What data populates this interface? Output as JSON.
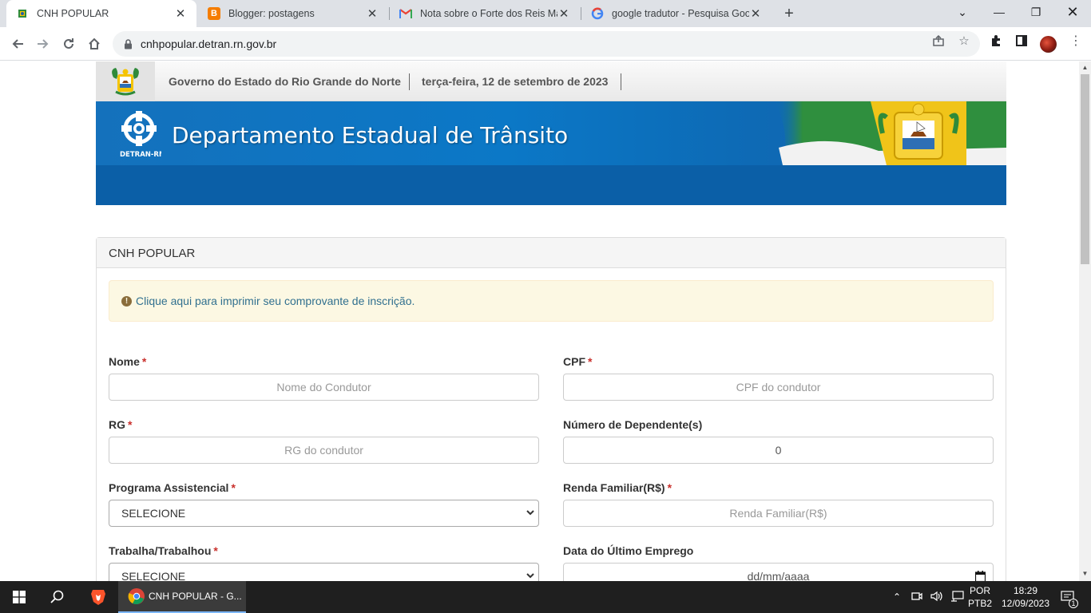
{
  "browser": {
    "tabs": [
      {
        "title": "CNH POPULAR",
        "active": true,
        "icon": "rn-crest-icon"
      },
      {
        "title": "Blogger: postagens",
        "active": false,
        "icon": "blogger-icon"
      },
      {
        "title": "Nota sobre o Forte dos Reis Mag",
        "active": false,
        "icon": "gmail-icon"
      },
      {
        "title": "google tradutor - Pesquisa Goog",
        "active": false,
        "icon": "google-icon"
      }
    ],
    "url": "cnhpopular.detran.rn.gov.br"
  },
  "page": {
    "gov_name": "Governo do Estado do Rio Grande do Norte",
    "date": "terça-feira, 12 de setembro de 2023",
    "banner_title": "Departamento Estadual de Trânsito",
    "logo_text": "DETRAN-RN",
    "panel_title": "CNH POPULAR",
    "alert_text": "Clique aqui para imprimir seu comprovante de inscrição."
  },
  "form": {
    "nome": {
      "label": "Nome",
      "placeholder": "Nome do Condutor",
      "required": "*"
    },
    "cpf": {
      "label": "CPF",
      "placeholder": "CPF do condutor",
      "required": "*"
    },
    "rg": {
      "label": "RG",
      "placeholder": "RG do condutor",
      "required": "*"
    },
    "dependentes": {
      "label": "Número de Dependente(s)",
      "value": "0"
    },
    "programa": {
      "label": "Programa Assistencial",
      "value": "SELECIONE",
      "required": "*"
    },
    "renda": {
      "label": "Renda Familiar(R$)",
      "placeholder": "Renda Familiar(R$)",
      "required": "*"
    },
    "trabalha": {
      "label": "Trabalha/Trabalhou",
      "value": "SELECIONE",
      "required": "*"
    },
    "ultimo_emprego": {
      "label": "Data do Último Emprego",
      "placeholder": "dd/mm/aaaa"
    }
  },
  "taskbar": {
    "app_label": "CNH POPULAR - G...",
    "lang_top": "POR",
    "lang_bottom": "PTB2",
    "time": "18:29",
    "date": "12/09/2023",
    "notif_count": "1"
  },
  "colors": {
    "banner_blue": "#0b78c7",
    "required_red": "#c9302c",
    "alert_bg": "#fcf8e3",
    "alert_text": "#31708f"
  }
}
